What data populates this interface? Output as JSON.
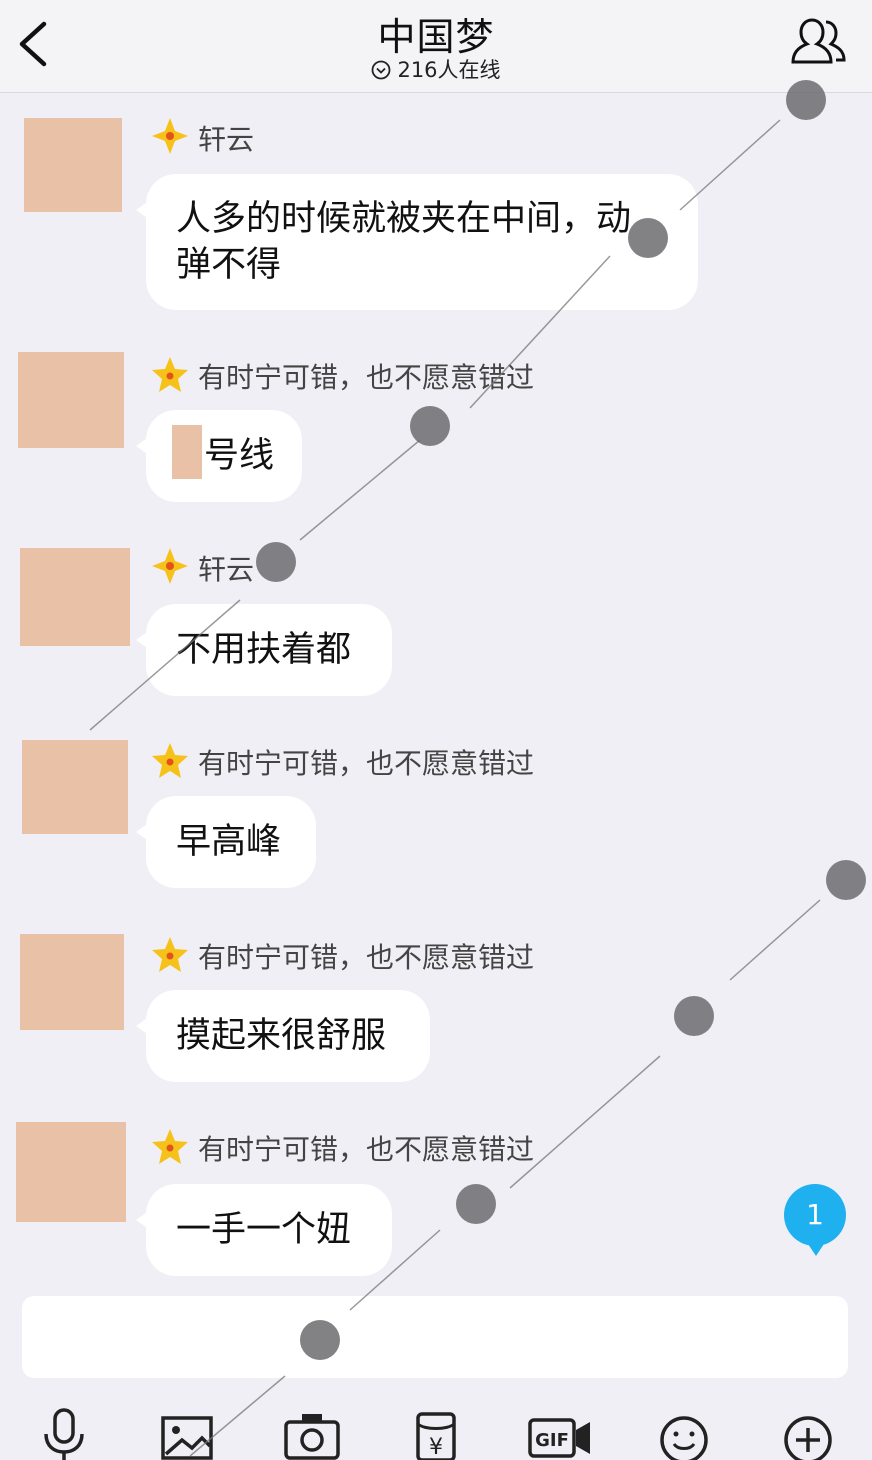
{
  "header": {
    "title": "中国梦",
    "online": "216人在线"
  },
  "messages": [
    {
      "name": "轩云",
      "star": "diamond",
      "text_lines": [
        "人多的时候就被夹在中间，动",
        "弹不得"
      ]
    },
    {
      "name": "有时宁可错，也不愿意错过",
      "star": "star",
      "text": "号线",
      "censored_prefix": true
    },
    {
      "name": "轩云",
      "star": "diamond",
      "text": "不用扶着都"
    },
    {
      "name": "有时宁可错，也不愿意错过",
      "star": "star",
      "text": "早高峰"
    },
    {
      "name": "有时宁可错，也不愿意错过",
      "star": "star",
      "text": "摸起来很舒服"
    },
    {
      "name": "有时宁可错，也不愿意错过",
      "star": "star",
      "text": "一手一个妞"
    }
  ],
  "unread_badge": "1",
  "input": {
    "value": ""
  },
  "toolbar": [
    "mic-icon",
    "image-icon",
    "camera-icon",
    "red-packet-icon",
    "gif-icon",
    "emoji-icon",
    "plus-icon"
  ],
  "colors": {
    "background": "#f0eff5",
    "bubble": "#ffffff",
    "badge": "#1fb0f0",
    "avatar_censor": "#e8c1a6"
  }
}
